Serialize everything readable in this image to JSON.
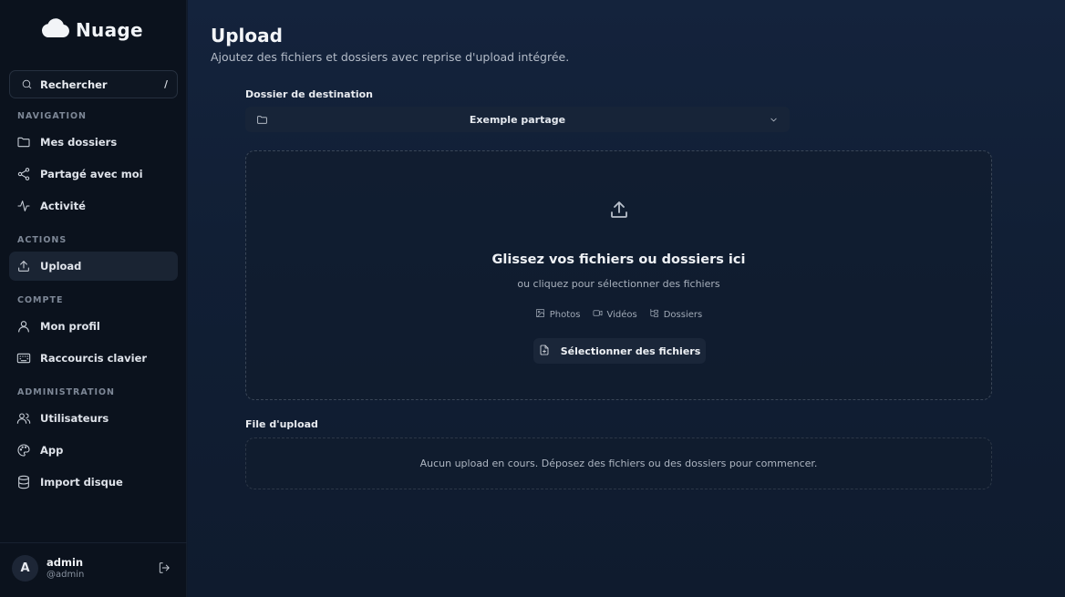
{
  "brand": {
    "name": "Nuage"
  },
  "search": {
    "label": "Rechercher",
    "shortcut": "/"
  },
  "sections": {
    "navigation": "NAVIGATION",
    "actions": "ACTIONS",
    "compte": "COMPTE",
    "administration": "ADMINISTRATION"
  },
  "nav": {
    "mes_dossiers": "Mes dossiers",
    "partage": "Partagé avec moi",
    "activite": "Activité",
    "upload": "Upload",
    "profil": "Mon profil",
    "raccourcis": "Raccourcis clavier",
    "utilisateurs": "Utilisateurs",
    "app": "App",
    "import": "Import disque"
  },
  "user": {
    "initial": "A",
    "name": "admin",
    "handle": "@admin"
  },
  "page": {
    "title": "Upload",
    "subtitle": "Ajoutez des fichiers et dossiers avec reprise d'upload intégrée."
  },
  "destination": {
    "label": "Dossier de destination",
    "value": "Exemple partage"
  },
  "dropzone": {
    "title": "Glissez vos fichiers ou dossiers ici",
    "subtitle": "ou cliquez pour sélectionner des fichiers",
    "types": [
      "Photos",
      "Vidéos",
      "Dossiers"
    ],
    "button": "Sélectionner des fichiers"
  },
  "queue": {
    "label": "File d'upload",
    "empty": "Aucun upload en cours. Déposez des fichiers ou des dossiers pour commencer."
  },
  "icons": {
    "brand": "cloud-icon",
    "search": "search-icon",
    "mes_dossiers": "folder-icon",
    "partage": "share-icon",
    "activite": "activity-icon",
    "upload": "upload-icon",
    "profil": "user-icon",
    "raccourcis": "keyboard-icon",
    "utilisateurs": "users-icon",
    "app": "palette-icon",
    "import": "database-icon",
    "logout": "logout-icon"
  }
}
